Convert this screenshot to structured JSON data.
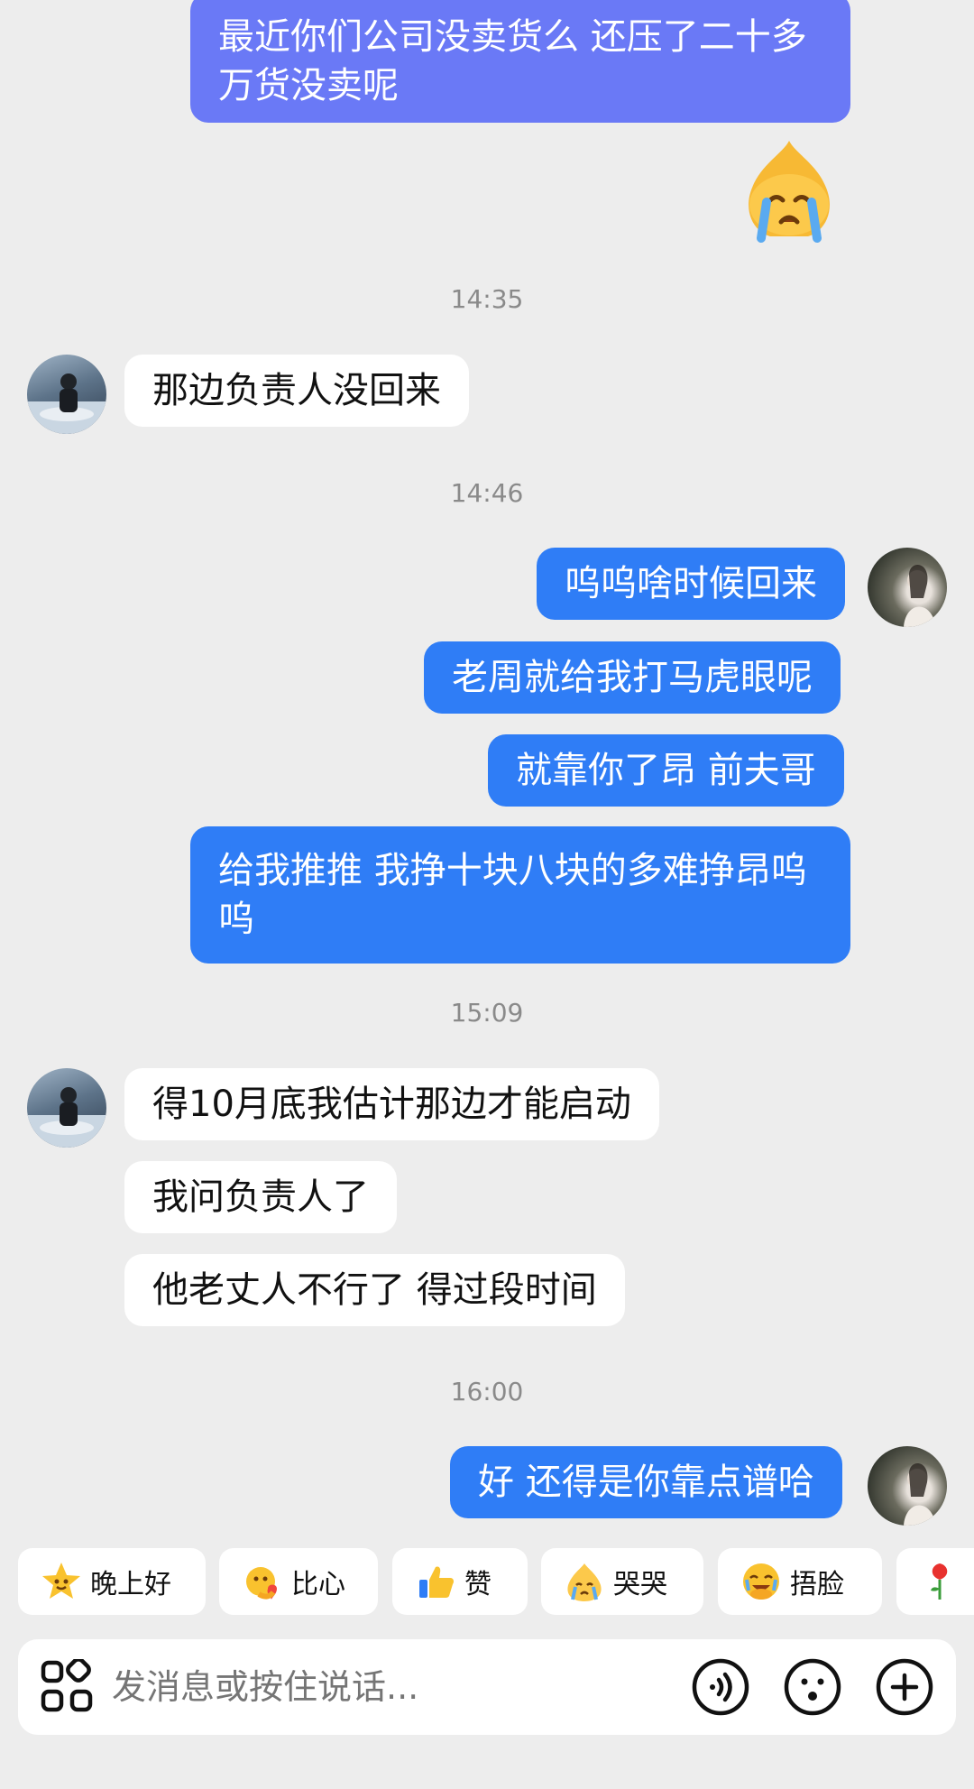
{
  "colors": {
    "background": "#ededed",
    "outgoing_bubble": "#2f7df6",
    "outgoing_bubble_alt": "#6a79f6",
    "incoming_bubble": "#ffffff",
    "timestamp": "#8a8a8a"
  },
  "messages": {
    "m1": "最近你们公司没卖货么 还压了二十多\n万货没卖呢",
    "m1_emoji": "loudly-crying-face",
    "t1": "14:35",
    "m2": "那边负责人没回来",
    "t2": "14:46",
    "m3": "呜呜啥时候回来",
    "m4": "老周就给我打马虎眼呢",
    "m5": "就靠你了昂 前夫哥",
    "m6": "给我推推 我挣十块八块的多难挣昂呜\n呜",
    "t3": "15:09",
    "m7": "得10月底我估计那边才能启动",
    "m8": "我问负责人了",
    "m9": "他老丈人不行了 得过段时间",
    "t4": "16:00",
    "m10": "好 还得是你靠点谱哈"
  },
  "quick_replies": [
    {
      "label": "晚上好",
      "icon": "star-face-icon"
    },
    {
      "label": "比心",
      "icon": "heart-hands-icon"
    },
    {
      "label": "赞",
      "icon": "thumbs-up-icon"
    },
    {
      "label": "哭哭",
      "icon": "crying-face-icon"
    },
    {
      "label": "捂脸",
      "icon": "facepalm-icon"
    },
    {
      "label": "",
      "icon": "rose-icon"
    }
  ],
  "input": {
    "placeholder": "发消息或按住说话...",
    "left_icon": "apps-grid-icon",
    "right_icons": [
      "voice-icon",
      "emoji-icon",
      "plus-icon"
    ]
  }
}
